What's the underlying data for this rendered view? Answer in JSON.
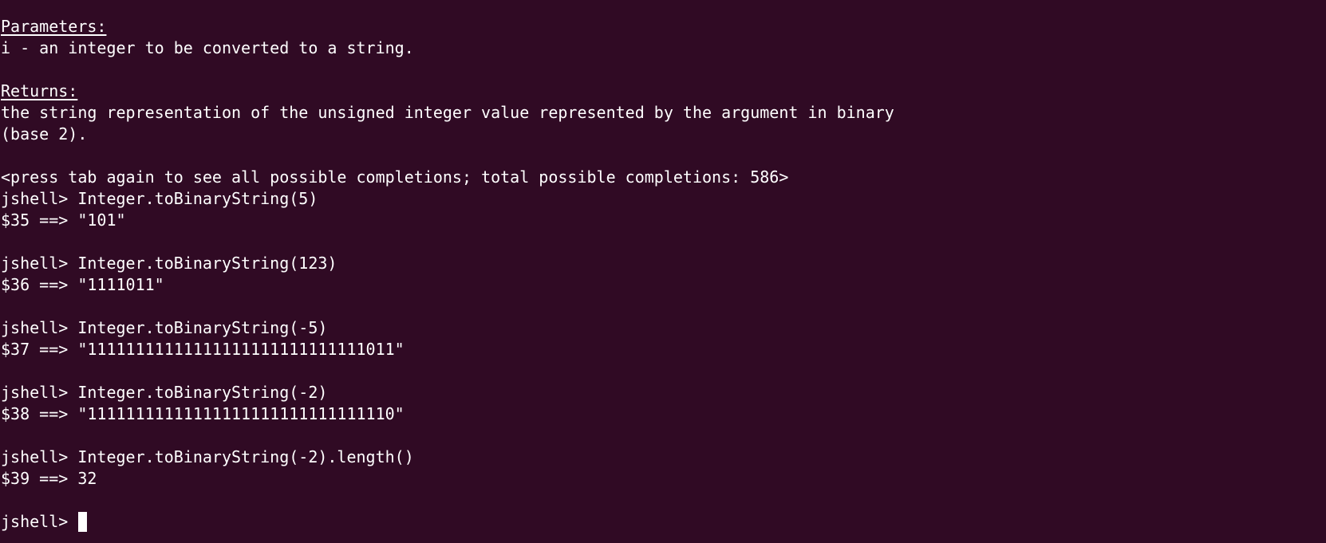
{
  "colors": {
    "background": "#300a24",
    "foreground": "#ffffff"
  },
  "doc": {
    "params_header": "Parameters:",
    "params_text": "i - an integer to be converted to a string.",
    "returns_header": "Returns:",
    "returns_line1": "the string representation of the unsigned integer value represented by the argument in binary",
    "returns_line2": "(base 2)."
  },
  "completion_hint": "<press tab again to see all possible completions; total possible completions: 586>",
  "session": [
    {
      "prompt": "jshell> ",
      "command": "Integer.toBinaryString(5)",
      "result": "$35 ==> \"101\""
    },
    {
      "prompt": "jshell> ",
      "command": "Integer.toBinaryString(123)",
      "result": "$36 ==> \"1111011\""
    },
    {
      "prompt": "jshell> ",
      "command": "Integer.toBinaryString(-5)",
      "result": "$37 ==> \"11111111111111111111111111111011\""
    },
    {
      "prompt": "jshell> ",
      "command": "Integer.toBinaryString(-2)",
      "result": "$38 ==> \"11111111111111111111111111111110\""
    },
    {
      "prompt": "jshell> ",
      "command": "Integer.toBinaryString(-2).length()",
      "result": "$39 ==> 32"
    }
  ],
  "current_prompt": "jshell> "
}
